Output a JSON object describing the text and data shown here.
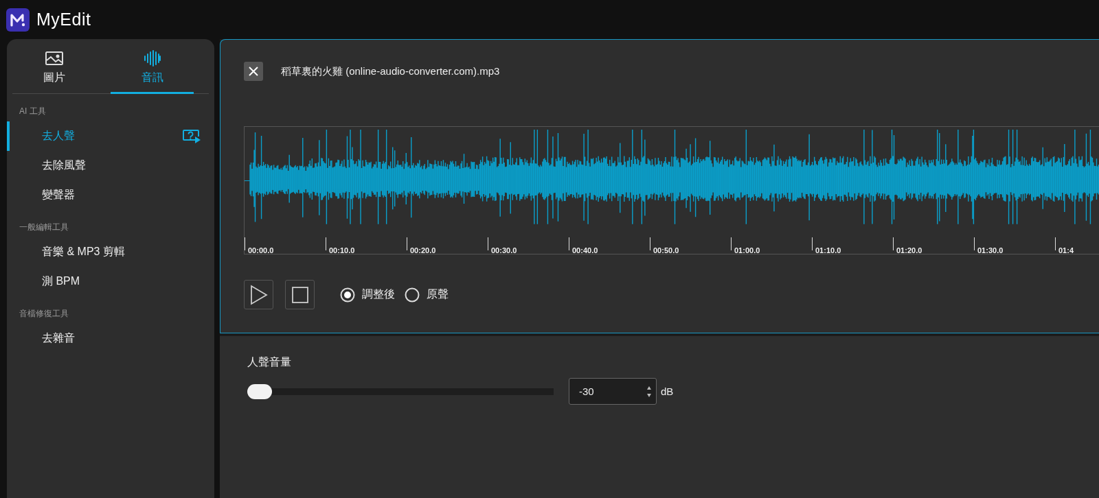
{
  "app": {
    "name": "MyEdit"
  },
  "sidebar": {
    "tabs": [
      {
        "label": "圖片",
        "selected": false
      },
      {
        "label": "音訊",
        "selected": true
      }
    ],
    "sections": [
      {
        "title": "AI 工具",
        "items": [
          {
            "label": "去人聲",
            "selected": true,
            "help_icon": true
          },
          {
            "label": "去除風聲",
            "selected": false,
            "help_icon": false
          },
          {
            "label": "變聲器",
            "selected": false,
            "help_icon": false
          }
        ]
      },
      {
        "title": "一般編輯工具",
        "items": [
          {
            "label": "音樂 & MP3 剪輯",
            "selected": false,
            "help_icon": false
          },
          {
            "label": "測 BPM",
            "selected": false,
            "help_icon": false
          }
        ]
      },
      {
        "title": "音檔修復工具",
        "items": [
          {
            "label": "去雜音",
            "selected": false,
            "help_icon": false
          }
        ]
      }
    ]
  },
  "player": {
    "file_name": "稻草裏的火雞 (online-audio-converter.com).mp3",
    "timeline": [
      "00:00.0",
      "00:10.0",
      "00:20.0",
      "00:30.0",
      "00:40.0",
      "00:50.0",
      "01:00.0",
      "01:10.0",
      "01:20.0",
      "01:30.0",
      "01:4"
    ],
    "modes": [
      {
        "label": "調整後",
        "selected": true
      },
      {
        "label": "原聲",
        "selected": false
      }
    ]
  },
  "settings": {
    "label": "人聲音量",
    "level": 0,
    "value": "-30",
    "unit": "dB"
  }
}
